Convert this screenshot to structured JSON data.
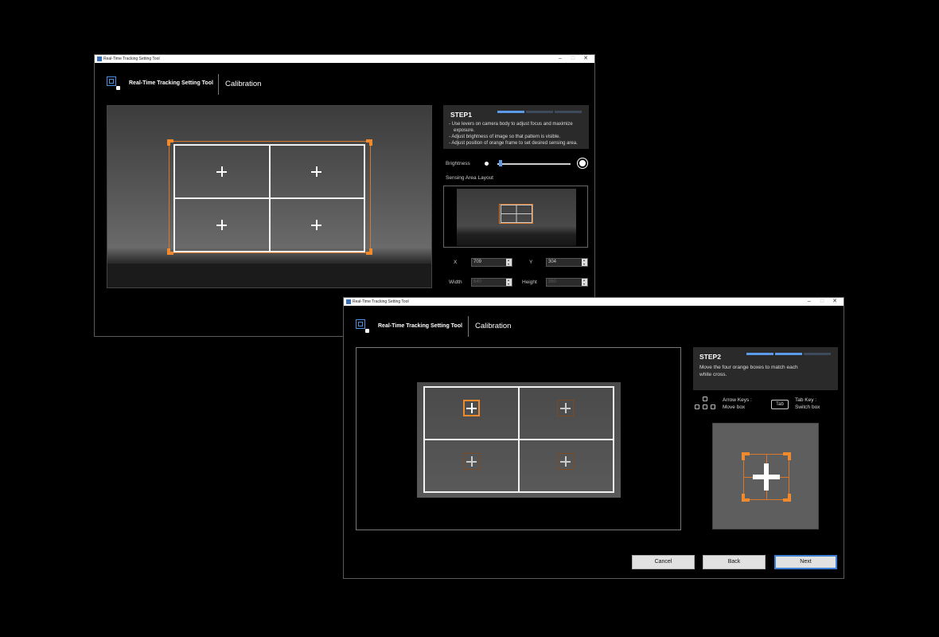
{
  "window1": {
    "title": "Real-Time Tracking Setting Tool",
    "app_name": "Real-Time Tracking Setting Tool",
    "page_title": "Calibration",
    "step": {
      "title": "STEP1",
      "progress_active": 1,
      "progress_total": 3,
      "lines": [
        "- Use levers on camera body to adjust focus and maximize",
        "  exposure.",
        "- Adjust brightness of image so that pattern is visible.",
        "- Adjust position of orange frame to set desired sensing area."
      ]
    },
    "brightness_label": "Brightness",
    "brightness_level": 0.02,
    "sensing_area_label": "Sensing Area Layout",
    "x_label": "X",
    "x_value": "709",
    "y_label": "Y",
    "y_value": "304",
    "width_label": "Width",
    "width_value": "640",
    "height_label": "Height",
    "height_value": "360"
  },
  "window2": {
    "title": "Real-Time Tracking Setting Tool",
    "app_name": "Real-Time Tracking Setting Tool",
    "page_title": "Calibration",
    "step": {
      "title": "STEP2",
      "progress_active": 2,
      "progress_total": 3,
      "lines": [
        "Move the four orange boxes to match each",
        "white cross."
      ]
    },
    "arrow_keys_label": "Arrow Keys :",
    "arrow_keys_action": "Move box",
    "tab_key_cap": "Tab",
    "tab_key_label": "Tab Key :",
    "tab_key_action": "Switch box",
    "buttons": {
      "cancel": "Cancel",
      "back": "Back",
      "next": "Next"
    }
  },
  "colors": {
    "accent_blue": "#5b9ae8",
    "orange": "#f08a2c",
    "panel_bg": "#2a2a2a"
  }
}
